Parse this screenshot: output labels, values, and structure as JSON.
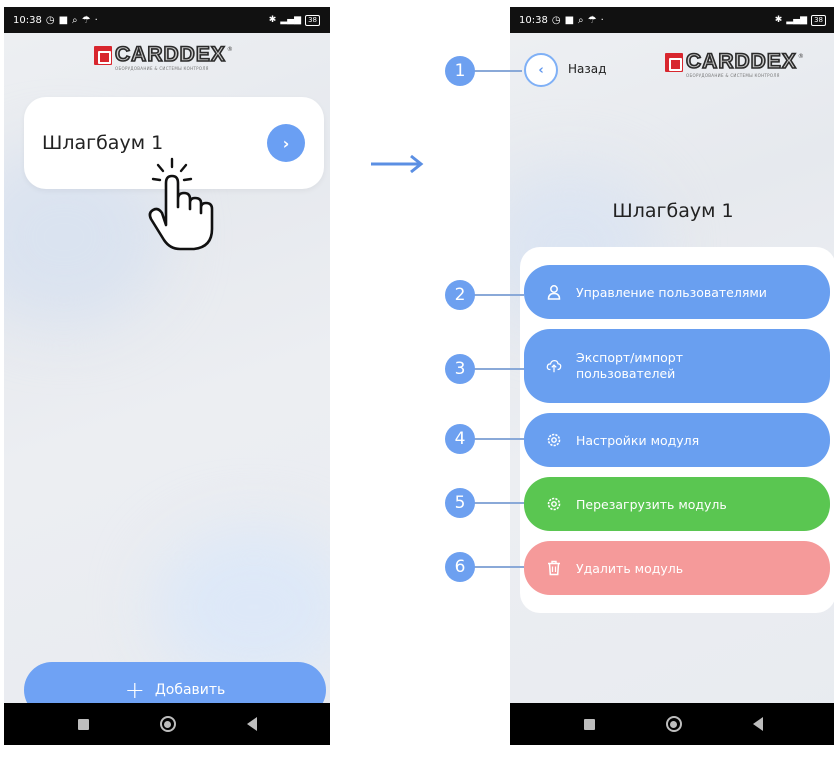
{
  "status_bar": {
    "time": "10:38",
    "battery": "38"
  },
  "logo": {
    "word": "CARDDEX",
    "subtitle": "ОБОРУДОВАНИЕ & СИСТЕМЫ КОНТРОЛЯ",
    "reg": "®"
  },
  "left_screen": {
    "device_name": "Шлагбаум 1",
    "open_icon": "›",
    "add_button": {
      "icon": "+",
      "label": "Добавить"
    }
  },
  "right_screen": {
    "back_icon": "‹",
    "back_label": "Назад",
    "title": "Шлагбаум 1",
    "menu": [
      {
        "label": "Управление пользователями",
        "icon": "user-icon",
        "color": "#699ff0"
      },
      {
        "label": "Экспорт/импорт",
        "label2": "пользователей",
        "icon": "cloud-upload-icon",
        "color": "#699ff0"
      },
      {
        "label": "Настройки модуля",
        "icon": "gear-icon",
        "color": "#699ff0"
      },
      {
        "label": "Перезагрузить модуль",
        "icon": "gear-icon",
        "color": "#5ac651"
      },
      {
        "label": "Удалить модуль",
        "icon": "trash-icon",
        "color": "#f59a9a"
      }
    ]
  },
  "callouts": [
    "1",
    "2",
    "3",
    "4",
    "5",
    "6"
  ]
}
